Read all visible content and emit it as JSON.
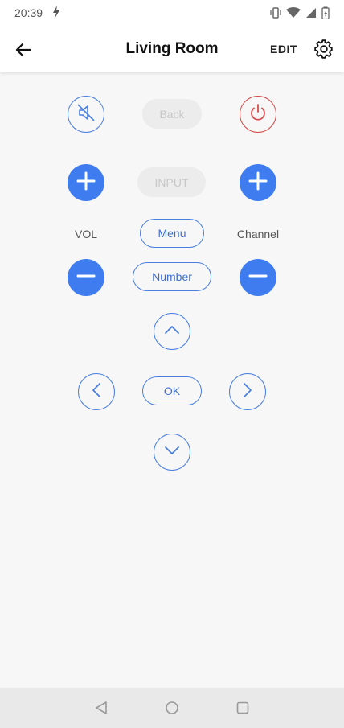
{
  "status": {
    "time": "20:39"
  },
  "header": {
    "title": "Living Room",
    "edit_label": "EDIT"
  },
  "remote": {
    "back_label": "Back",
    "input_label": "INPUT",
    "vol_label": "VOL",
    "channel_label": "Channel",
    "menu_label": "Menu",
    "number_label": "Number",
    "ok_label": "OK"
  },
  "icons": {
    "mute": "mute-icon",
    "power": "power-icon",
    "plus": "plus-icon",
    "minus": "minus-icon",
    "up": "chevron-up-icon",
    "down": "chevron-down-icon",
    "left": "chevron-left-icon",
    "right": "chevron-right-icon",
    "settings": "gear-icon"
  },
  "colors": {
    "accent": "#3f7cf0",
    "power": "#d84a4a",
    "disabled": "#ececec"
  }
}
